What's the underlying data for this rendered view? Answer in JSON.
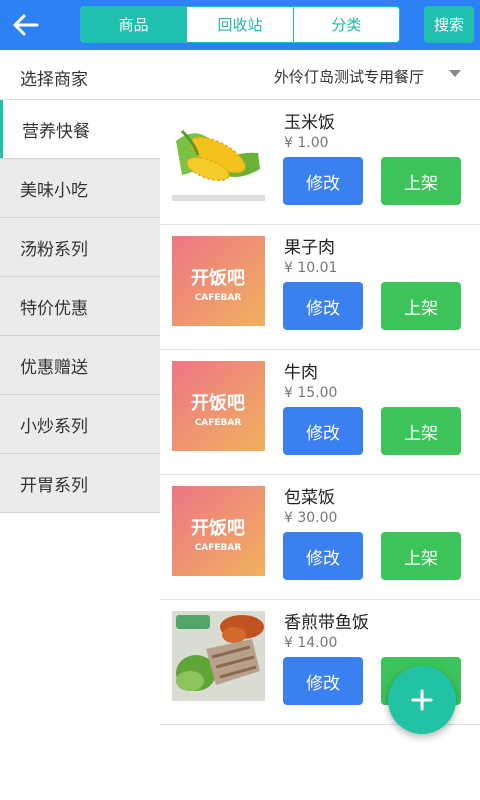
{
  "header": {
    "tabs": [
      {
        "label": "商品",
        "active": true
      },
      {
        "label": "回收站",
        "active": false
      },
      {
        "label": "分类",
        "active": false
      }
    ],
    "search_label": "搜索"
  },
  "merchant": {
    "label": "选择商家",
    "value": "外伶仃岛测试专用餐厅"
  },
  "categories": [
    {
      "label": "营养快餐",
      "active": true
    },
    {
      "label": "美味小吃",
      "active": false
    },
    {
      "label": "汤粉系列",
      "active": false
    },
    {
      "label": "特价优惠",
      "active": false
    },
    {
      "label": "优惠赠送",
      "active": false
    },
    {
      "label": "小炒系列",
      "active": false
    },
    {
      "label": "开胃系列",
      "active": false
    }
  ],
  "products": [
    {
      "name": "玉米饭",
      "price": "¥ 1.00",
      "image": "corn",
      "edit_label": "修改",
      "shelf_label": "上架"
    },
    {
      "name": "果子肉",
      "price": "¥ 10.01",
      "image": "cafebar-logo",
      "logo_text": "开饭吧",
      "logo_sub": "CAFEBAR",
      "edit_label": "修改",
      "shelf_label": "上架"
    },
    {
      "name": "牛肉",
      "price": "¥ 15.00",
      "image": "cafebar-logo",
      "logo_text": "开饭吧",
      "logo_sub": "CAFEBAR",
      "edit_label": "修改",
      "shelf_label": "上架"
    },
    {
      "name": "包菜饭",
      "price": "¥ 30.00",
      "image": "cafebar-logo",
      "logo_text": "开饭吧",
      "logo_sub": "CAFEBAR",
      "edit_label": "修改",
      "shelf_label": "上架"
    },
    {
      "name": "香煎带鱼饭",
      "price": "¥ 14.00",
      "image": "fish-dish",
      "edit_label": "修改",
      "shelf_label": "上架"
    }
  ],
  "colors": {
    "header_bg": "#2c82f4",
    "accent": "#1fc0b0",
    "edit_button": "#3a80f0",
    "shelf_button": "#3cc35a"
  },
  "icons": [
    "back-arrow-icon",
    "dropdown-arrow-icon",
    "plus-icon"
  ]
}
